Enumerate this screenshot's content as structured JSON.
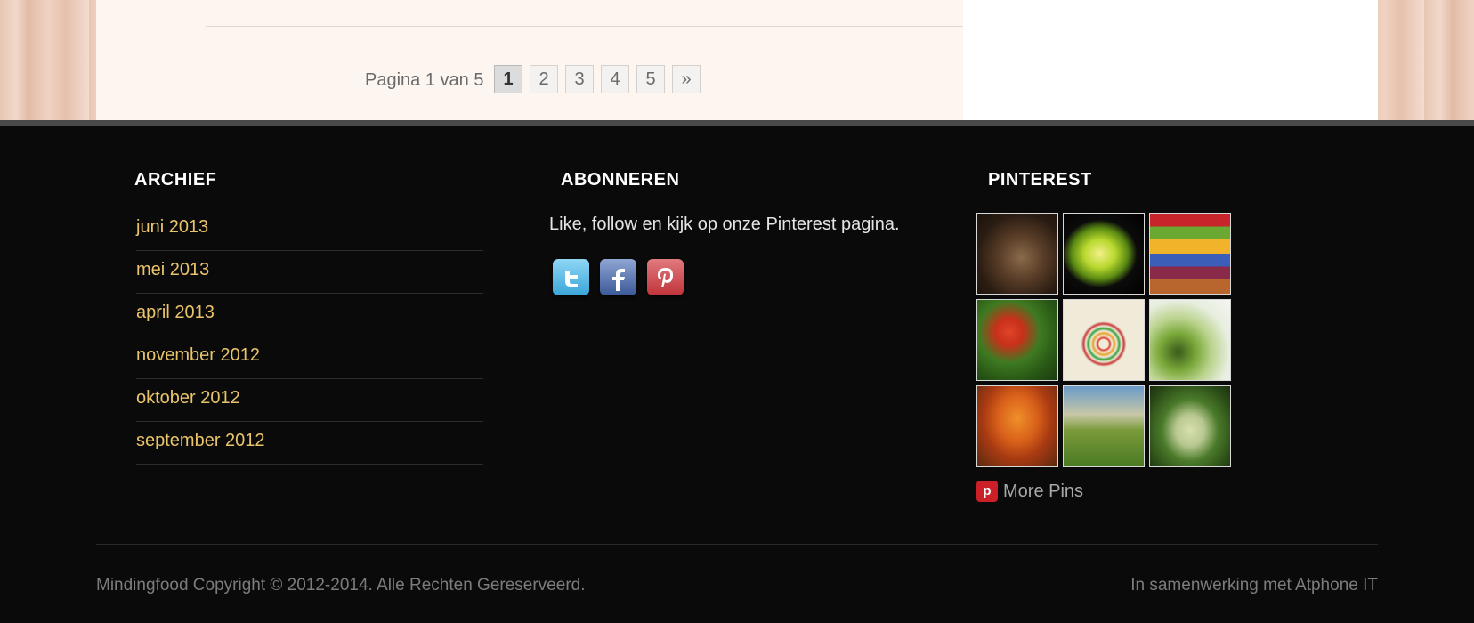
{
  "pagination": {
    "label": "Pagina 1 van 5",
    "pages": [
      "1",
      "2",
      "3",
      "4",
      "5"
    ],
    "current": "1",
    "next": "»"
  },
  "footer": {
    "archive": {
      "title": "ARCHIEF",
      "items": [
        "juni 2013",
        "mei 2013",
        "april 2013",
        "november 2012",
        "oktober 2012",
        "september 2012"
      ]
    },
    "subscribe": {
      "title": "ABONNEREN",
      "text": "Like, follow en kijk op onze Pinterest pagina.",
      "icons": [
        "twitter-icon",
        "facebook-icon",
        "pinterest-icon"
      ]
    },
    "pinterest": {
      "title": "PINTEREST",
      "more_label": "More Pins",
      "pins": [
        "walnuts-pin",
        "kiwi-slice-pin",
        "fruit-stripes-pin",
        "goji-berries-pin",
        "fruits-chart-pin",
        "kiwi-halves-pin",
        "autumn-tree-quote-pin",
        "green-hills-quote-pin",
        "buddha-pear-pin"
      ]
    },
    "copyright": "Mindingfood Copyright © 2012-2014. Alle Rechten Gereserveerd.",
    "credit": "In samenwerking met Atphone IT"
  },
  "colors": {
    "link": "#e9c46a",
    "footer_bg": "#0a0a0a",
    "pinterest_red": "#cb2027"
  }
}
